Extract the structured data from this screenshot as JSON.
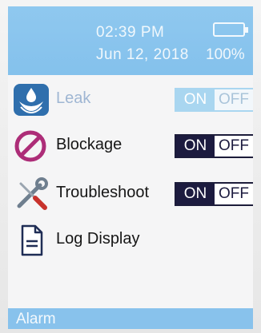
{
  "status": {
    "time": "02:39 PM",
    "date": "Jun 12, 2018",
    "battery_percent": "100%",
    "battery_icon": "battery-icon"
  },
  "menu": {
    "items": [
      {
        "label": "Leak",
        "icon": "water-drop-icon",
        "toggle": {
          "on": "ON",
          "off": "OFF",
          "state": "on",
          "enabled": false
        }
      },
      {
        "label": "Blockage",
        "icon": "no-entry-icon",
        "toggle": {
          "on": "ON",
          "off": "OFF",
          "state": "on",
          "enabled": true
        }
      },
      {
        "label": "Troubleshoot",
        "icon": "tools-icon",
        "toggle": {
          "on": "ON",
          "off": "OFF",
          "state": "on",
          "enabled": true
        }
      },
      {
        "label": "Log Display",
        "icon": "document-icon"
      }
    ]
  },
  "bottom_bar": {
    "label": "Alarm"
  },
  "colors": {
    "header": "#8fc8ef",
    "toggle_active": "#1c1b3f",
    "toggle_disabled": "#a9d6f0",
    "blockage_icon": "#ad2d78",
    "leak_icon": "#2f6fad"
  }
}
